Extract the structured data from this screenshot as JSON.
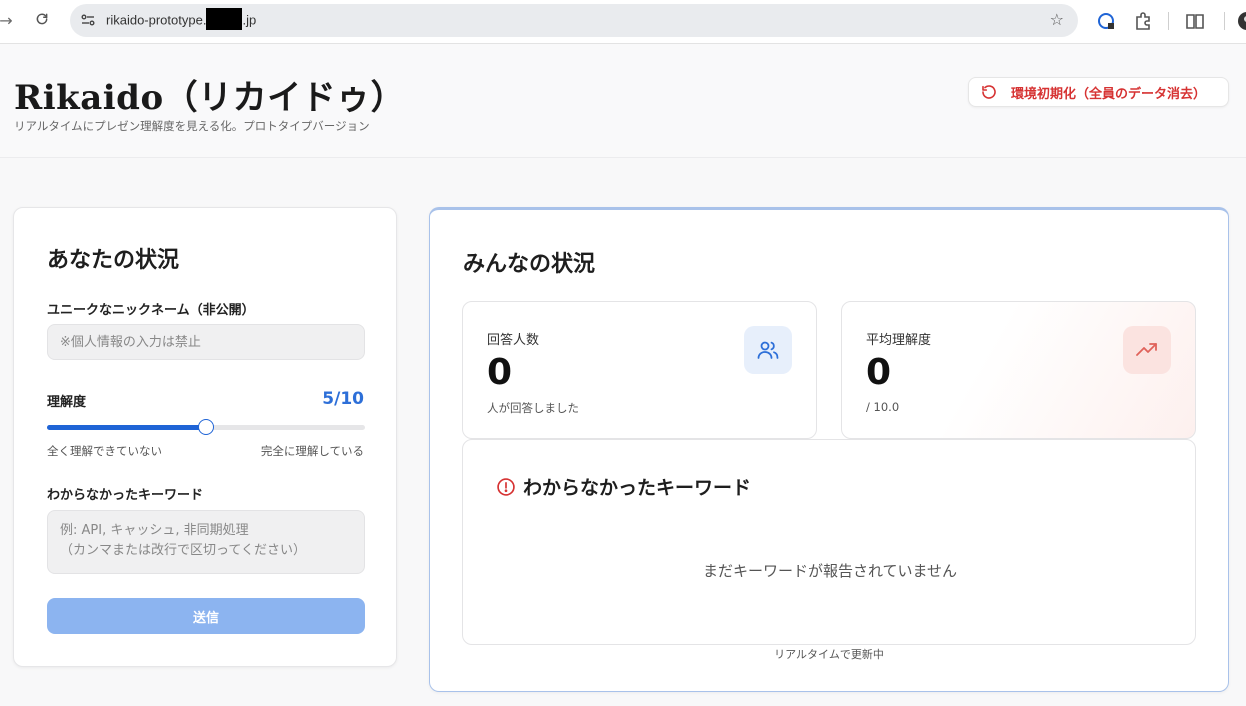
{
  "browser": {
    "url_prefix": "rikaido-prototype.",
    "url_suffix": ".jp"
  },
  "header": {
    "title": "Rikaido（リカイドゥ）",
    "subtitle": "リアルタイムにプレゼン理解度を見える化。プロトタイプバージョン",
    "reset_label": "環境初期化（全員のデータ消去）"
  },
  "your_status": {
    "title": "あなたの状況",
    "nickname_label": "ユニークなニックネーム（非公開）",
    "nickname_value": "",
    "nickname_placeholder": "※個人情報の入力は禁止",
    "understanding_label": "理解度",
    "understanding_score": "5/10",
    "understanding_level": 0.5,
    "slider_min_label": "全く理解できていない",
    "slider_max_label": "完全に理解している",
    "keywords_label": "わからなかったキーワード",
    "keywords_value": "",
    "keywords_placeholder": "例: API, キャッシュ, 非同期処理\n（カンマまたは改行で区切ってください）",
    "submit_label": "送信"
  },
  "everyone_status": {
    "title": "みんなの状況",
    "respondents": {
      "label": "回答人数",
      "value": "0",
      "sub": "人が回答しました",
      "icon": "users-icon"
    },
    "average": {
      "label": "平均理解度",
      "value": "0",
      "sub": "/ 10.0",
      "icon": "trending-up-icon"
    },
    "keywords": {
      "title": "わからなかったキーワード",
      "empty": "まだキーワードが報告されていません"
    },
    "footnote": "リアルタイムで更新中"
  },
  "colors": {
    "accent": "#1f64d6",
    "danger": "#d63232",
    "submit_disabled": "#8cb4f0"
  }
}
